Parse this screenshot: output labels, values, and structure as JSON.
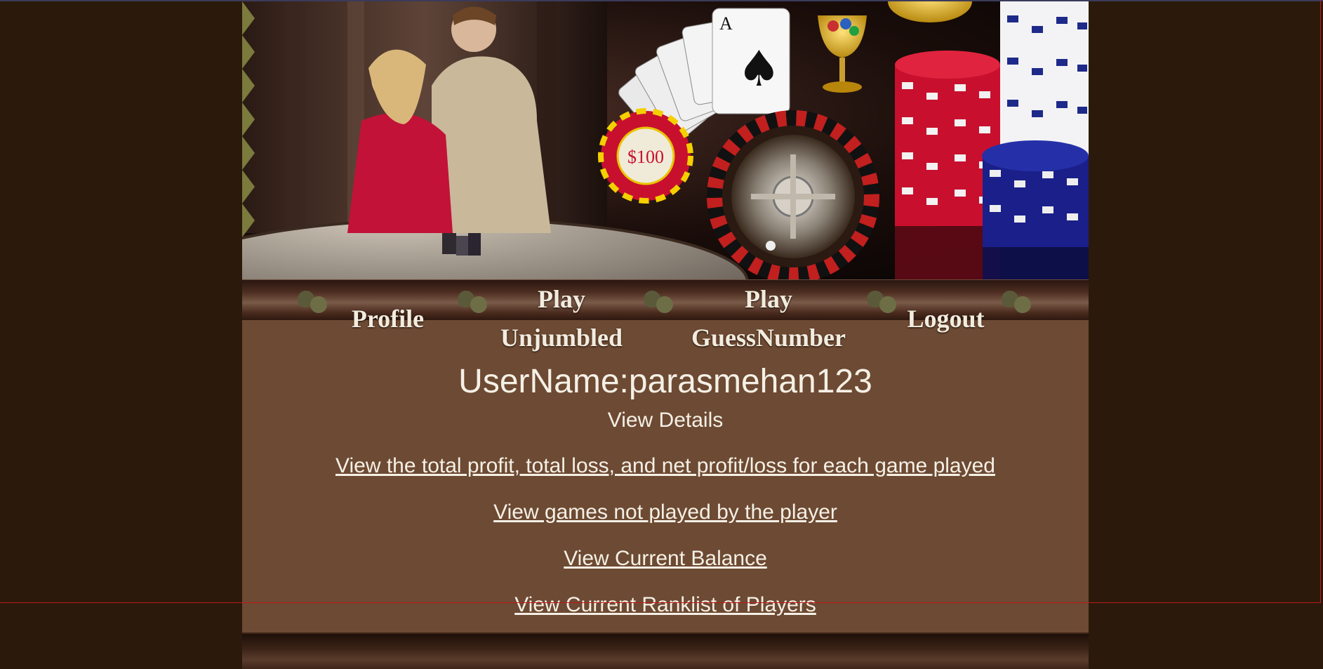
{
  "banner": {
    "chip_label": "$100"
  },
  "nav": {
    "items": [
      {
        "label": "Profile"
      },
      {
        "label": "Play Unjumbled"
      },
      {
        "label": "Play GuessNumber"
      },
      {
        "label": "Logout"
      }
    ]
  },
  "main": {
    "username_label": "UserName:parasmehan123",
    "details_heading": "View Details",
    "links": [
      {
        "label": "View the total profit, total loss, and net profit/loss for each game played"
      },
      {
        "label": "View games not played by the player"
      },
      {
        "label": "View Current Balance"
      },
      {
        "label": "View Current Ranklist of Players"
      }
    ]
  },
  "colors": {
    "page_background": "#2b1a0b",
    "content_background": "#6d4a33",
    "text": "#f5f0e6"
  }
}
